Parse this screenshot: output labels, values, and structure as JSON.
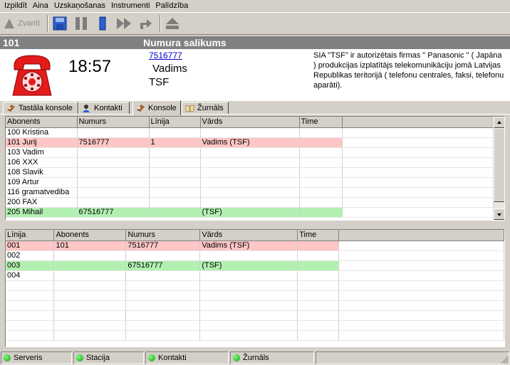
{
  "menu": [
    "Izpildīt",
    "Aina",
    "Uzskaņošanas",
    "Instrumenti",
    "Palīdzība"
  ],
  "toolbar": {
    "call_label": "Zvanīt",
    "icons": [
      "call-icon",
      "save-icon",
      "pause-icon",
      "stop-icon",
      "fast-forward-icon",
      "redirect-icon",
      "eject-icon"
    ]
  },
  "header": {
    "number": "101",
    "title": "Numura salikums"
  },
  "call": {
    "time": "18:57",
    "number": "7516777",
    "name": "Vadims",
    "org": "TSF",
    "description": "SIA \"TSF\" ir autorizētais firmas \" Panasonic \" ( Japāna ) produkcijas izplatītājs telekomunikāciju jomā Latvijas Republikas teritorijā ( telefonu centrales, faksi, telefonu aparāti)."
  },
  "tabs": [
    {
      "label": "Tastāla konsole",
      "icon": "keypad-icon"
    },
    {
      "label": "Kontakti",
      "icon": "contact-icon"
    },
    {
      "label": "Konsole",
      "icon": "console-icon",
      "active": true
    },
    {
      "label": "Žurnāls",
      "icon": "journal-icon"
    }
  ],
  "subscribers": {
    "columns": [
      "Abonents",
      "Numurs",
      "Līnija",
      "Vārds",
      "Time"
    ],
    "rows": [
      {
        "cells": [
          "100 Kristina",
          "",
          "",
          "",
          ""
        ],
        "status": ""
      },
      {
        "cells": [
          "101 Jurij",
          "7516777",
          "1",
          "Vadims (TSF)",
          ""
        ],
        "status": "active"
      },
      {
        "cells": [
          "103 Vadim",
          "",
          "",
          "",
          ""
        ],
        "status": ""
      },
      {
        "cells": [
          "106 XXX",
          "",
          "",
          "",
          ""
        ],
        "status": ""
      },
      {
        "cells": [
          "108 Slavik",
          "",
          "",
          "",
          ""
        ],
        "status": ""
      },
      {
        "cells": [
          "109 Artur",
          "",
          "",
          "",
          ""
        ],
        "status": ""
      },
      {
        "cells": [
          "116 gramatvediba",
          "",
          "",
          "",
          ""
        ],
        "status": ""
      },
      {
        "cells": [
          "200 FAX",
          "",
          "",
          "",
          ""
        ],
        "status": ""
      },
      {
        "cells": [
          "205 Mihail",
          "67516777",
          "",
          "(TSF)",
          ""
        ],
        "status": "ringing"
      }
    ]
  },
  "lines": {
    "columns": [
      "Līnija",
      "Abonents",
      "Numurs",
      "Vārds",
      "Time"
    ],
    "rows": [
      {
        "cells": [
          "001",
          "101",
          "7516777",
          "Vadims (TSF)",
          ""
        ],
        "status": "active"
      },
      {
        "cells": [
          "002",
          "",
          "",
          "",
          ""
        ],
        "status": ""
      },
      {
        "cells": [
          "003",
          "",
          "67516777",
          "(TSF)",
          ""
        ],
        "status": "ringing"
      },
      {
        "cells": [
          "004",
          "",
          "",
          "",
          ""
        ],
        "status": ""
      },
      {
        "cells": [
          "",
          "",
          "",
          "",
          ""
        ],
        "status": ""
      },
      {
        "cells": [
          "",
          "",
          "",
          "",
          ""
        ],
        "status": ""
      },
      {
        "cells": [
          "",
          "",
          "",
          "",
          ""
        ],
        "status": ""
      },
      {
        "cells": [
          "",
          "",
          "",
          "",
          ""
        ],
        "status": ""
      },
      {
        "cells": [
          "",
          "",
          "",
          "",
          ""
        ],
        "status": ""
      },
      {
        "cells": [
          "",
          "",
          "",
          "",
          ""
        ],
        "status": ""
      }
    ]
  },
  "status": [
    {
      "label": "Serveris",
      "state": "ok"
    },
    {
      "label": "Stacija",
      "state": "ok"
    },
    {
      "label": "Kontakti",
      "state": "ok"
    },
    {
      "label": "Žurnāls",
      "state": "ok"
    }
  ],
  "colors": {
    "active_row": "#ffc6c6",
    "ringing_row": "#b2f0b2",
    "phone": "#e31b1b",
    "link": "#0000cc"
  }
}
